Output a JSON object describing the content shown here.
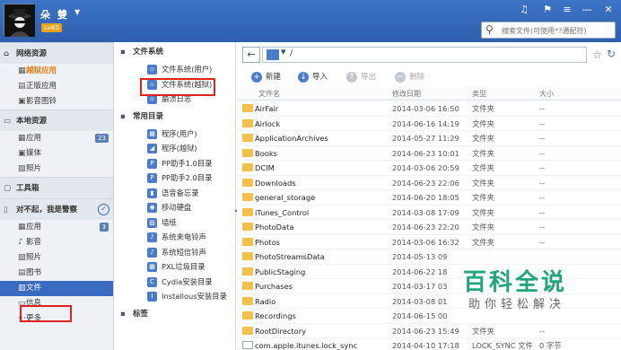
{
  "topbar": {
    "username": "朵 雙",
    "level": "Lv60",
    "search_placeholder": "搜索文件(可使用*?通配符)"
  },
  "sidebar": {
    "sections": [
      {
        "label": "网络资源",
        "items": [
          {
            "label": "越狱应用",
            "badge": ""
          },
          {
            "label": "正版应用",
            "badge": ""
          },
          {
            "label": "影音图铃",
            "badge": ""
          }
        ]
      },
      {
        "label": "本地资源",
        "items": [
          {
            "label": "应用",
            "badge": "23"
          },
          {
            "label": "媒体",
            "badge": ""
          },
          {
            "label": "照片",
            "badge": ""
          }
        ]
      },
      {
        "label": "工具箱",
        "items": []
      },
      {
        "label": "对不起，我是警察",
        "items": [
          {
            "label": "应用",
            "badge": "3"
          },
          {
            "label": "影音",
            "badge": ""
          },
          {
            "label": "照片",
            "badge": ""
          },
          {
            "label": "图书",
            "badge": ""
          },
          {
            "label": "文件",
            "badge": ""
          },
          {
            "label": "信息",
            "badge": ""
          },
          {
            "label": "更多",
            "badge": ""
          }
        ]
      }
    ]
  },
  "tree": {
    "fs_header": "文件系统",
    "fs_items": [
      "文件系统(用户)",
      "文件系统(越狱)",
      "崩溃日志"
    ],
    "common_header": "常用目录",
    "common_items": [
      "程序(用户)",
      "程序(越狱)",
      "PP助手1.0目录",
      "PP助手2.0目录",
      "语音备忘录",
      "移动硬盘",
      "墙纸",
      "系统来电铃声",
      "系统短信铃声",
      "PXL垃圾目录",
      "Cydia安装目录",
      "Installous安装目录"
    ],
    "bottom_header": "标签"
  },
  "addressbar": {
    "path": "/"
  },
  "toolbar": {
    "new": "新建",
    "import": "导入",
    "export": "导出",
    "delete": "删除"
  },
  "columns": {
    "name": "文件名",
    "modified": "修改日期",
    "type": "类型",
    "size": "大小"
  },
  "files": [
    {
      "name": "AirFair",
      "date": "2014-03-06 16:50",
      "type": "文件夹",
      "size": "--"
    },
    {
      "name": "Airlock",
      "date": "2014-06-16 14:19",
      "type": "文件夹",
      "size": "--"
    },
    {
      "name": "ApplicationArchives",
      "date": "2014-05-27 11:29",
      "type": "文件夹",
      "size": "--"
    },
    {
      "name": "Books",
      "date": "2014-06-23 10:01",
      "type": "文件夹",
      "size": "--"
    },
    {
      "name": "DCIM",
      "date": "2014-03-06 20:59",
      "type": "文件夹",
      "size": "--"
    },
    {
      "name": "Downloads",
      "date": "2014-06-23 22:06",
      "type": "文件夹",
      "size": "--"
    },
    {
      "name": "general_storage",
      "date": "2014-06-20 18:05",
      "type": "文件夹",
      "size": "--"
    },
    {
      "name": "iTunes_Control",
      "date": "2014-03-08 17:09",
      "type": "文件夹",
      "size": "--"
    },
    {
      "name": "PhotoData",
      "date": "2014-06-23 22:20",
      "type": "文件夹",
      "size": "--"
    },
    {
      "name": "Photos",
      "date": "2014-03-06 16:32",
      "type": "文件夹",
      "size": "--"
    },
    {
      "name": "PhotoStreamsData",
      "date": "2014-05-13 09",
      "type": "",
      "size": ""
    },
    {
      "name": "PublicStaging",
      "date": "2014-06-22 18",
      "type": "",
      "size": ""
    },
    {
      "name": "Purchases",
      "date": "2014-03-17 03",
      "type": "",
      "size": ""
    },
    {
      "name": "Radio",
      "date": "2014-03-08 01",
      "type": "",
      "size": ""
    },
    {
      "name": "Recordings",
      "date": "2014-06-15 00",
      "type": "",
      "size": ""
    },
    {
      "name": "RootDirectory",
      "date": "2014-06-23 15:49",
      "type": "文件夹",
      "size": "--"
    },
    {
      "name": "com.apple.itunes.lock_sync",
      "date": "2014-04-10 17:18",
      "type": "LOCK_SYNC 文件",
      "size": "0 字节"
    }
  ],
  "watermark": {
    "title": "百科全说",
    "subtitle": "助你轻松解决"
  },
  "colors": {
    "topbar": "#3d74c6",
    "accent": "#3a6bc1",
    "active": "#e97a10",
    "highlight": "#e0221c",
    "watermark": "#1fa67a"
  }
}
